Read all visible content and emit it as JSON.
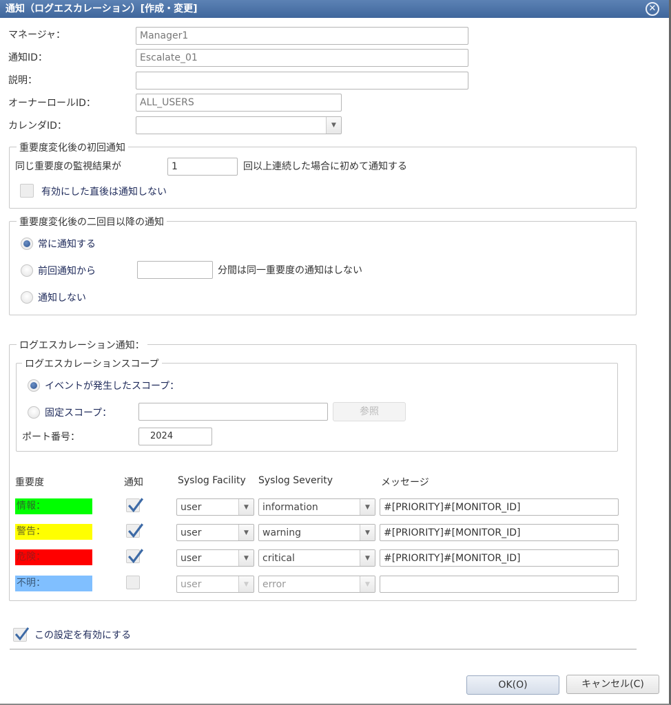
{
  "dialog": {
    "title": "通知（ログエスカレーション）[作成・変更]",
    "close_icon": "⊗"
  },
  "fields": {
    "manager": {
      "label": "マネージャ：",
      "value": "Manager1"
    },
    "notify_id": {
      "label": "通知ID：",
      "value": "Escalate_01"
    },
    "description": {
      "label": "説明：",
      "value": ""
    },
    "owner_role_id": {
      "label": "オーナーロールID：",
      "value": "ALL_USERS"
    },
    "calendar_id": {
      "label": "カレンダID：",
      "value": ""
    }
  },
  "initial_notify": {
    "legend": "重要度変化後の初回通知",
    "prefix": "同じ重要度の監視結果が",
    "count_value": "1",
    "suffix": "回以上連続した場合に初めて通知する",
    "checkbox_label": "有効にした直後は通知しない",
    "checkbox_checked": false
  },
  "subsequent_notify": {
    "legend": "重要度変化後の二回目以降の通知",
    "options": [
      {
        "label": "常に通知する",
        "selected": true
      },
      {
        "label": "前回通知から",
        "selected": false
      },
      {
        "label": "通知しない",
        "selected": false
      }
    ],
    "minutes_value": "",
    "minutes_suffix": "分間は同一重要度の通知はしない"
  },
  "log_escalation": {
    "legend": "ログエスカレーション通知：",
    "scope": {
      "legend": "ログエスカレーションスコープ",
      "event_scope_label": "イベントが発生したスコープ：",
      "event_scope_selected": true,
      "fixed_scope_label": "固定スコープ：",
      "fixed_scope_selected": false,
      "fixed_scope_value": "",
      "browse_label": "参照",
      "port_label": "ポート番号：",
      "port_value": "2024"
    },
    "table": {
      "headers": {
        "severity": "重要度",
        "notify": "通知",
        "facility": "Syslog Facility",
        "sev": "Syslog Severity",
        "message": "メッセージ"
      },
      "rows": [
        {
          "label": "情報：",
          "color": "#00ff00",
          "text_color": "#2a6a2a",
          "checked": true,
          "facility": "user",
          "severity": "information",
          "message": "#[PRIORITY]#[MONITOR_ID]",
          "enabled": true
        },
        {
          "label": "警告：",
          "color": "#ffff00",
          "text_color": "#6a6a20",
          "checked": true,
          "facility": "user",
          "severity": "warning",
          "message": "#[PRIORITY]#[MONITOR_ID]",
          "enabled": true
        },
        {
          "label": "危険：",
          "color": "#ff0000",
          "text_color": "#a01818",
          "checked": true,
          "facility": "user",
          "severity": "critical",
          "message": "#[PRIORITY]#[MONITOR_ID]",
          "enabled": true
        },
        {
          "label": "不明：",
          "color": "#80bfff",
          "text_color": "#3a5a7a",
          "checked": false,
          "facility": "user",
          "severity": "error",
          "message": "",
          "enabled": false
        }
      ]
    }
  },
  "enable_setting": {
    "label": "この設定を有効にする",
    "checked": true
  },
  "buttons": {
    "ok": "OK(O)",
    "cancel": "キャンセル(C)"
  }
}
